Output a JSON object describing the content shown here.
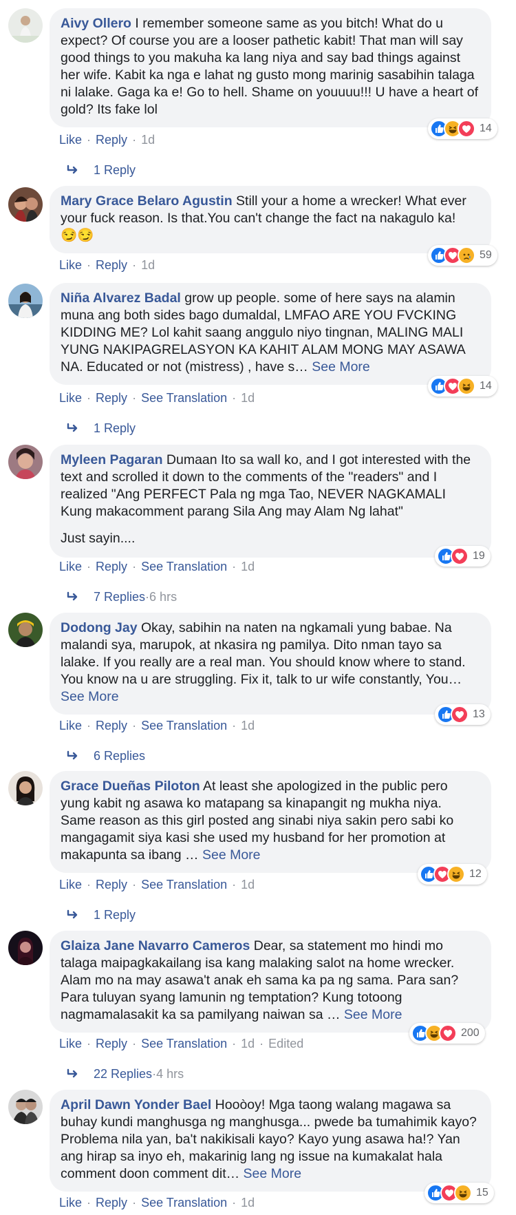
{
  "labels": {
    "like": "Like",
    "reply": "Reply",
    "see_translation": "See Translation",
    "see_more": "See More"
  },
  "colors": {
    "link": "#385898",
    "meta": "#90949c",
    "bubble": "#f2f3f5",
    "like": "#1877f2",
    "love": "#f33e58",
    "haha": "#f7b125"
  },
  "comments": [
    {
      "author": "Aivy Ollero",
      "text": " I remember someone same as you bitch! What do u expect? Of course you are a looser pathetic kabit! That man will say good things to you makuha ka lang niya and say bad things against her wife. Kabit ka nga e lahat ng gusto mong marinig sasabihin talaga ni lalake. Gaga ka e! Go to hell. Shame on youuuu!!! U have a heart of gold? Its fake lol",
      "time": "1d",
      "reactions": [
        "like-icon",
        "haha-icon",
        "love-icon"
      ],
      "reaction_count": "14",
      "replies": "1 Reply"
    },
    {
      "author": "Mary Grace Belaro Agustin",
      "text": " Still your a home a wrecker! What ever your fuck reason. Is that.You can't change the fact na nakagulo ka!",
      "emoji": "😏😏",
      "time": "1d",
      "reactions": [
        "like-icon",
        "love-icon",
        "sad-icon"
      ],
      "reaction_count": "59"
    },
    {
      "author": "Niña Alvarez Badal",
      "text": " grow up people. some of here says na alamin muna ang both sides bago dumaldal, LMFAO ARE YOU FVCKING KIDDING ME? Lol kahit saang anggulo niyo tingnan, MALING MALI YUNG NAKIPAGRELASYON KA KAHIT ALAM MONG MAY ASAWA NA. Educated or not (mistress) , have s…",
      "time": "1d",
      "reactions": [
        "like-icon",
        "love-icon",
        "haha-icon"
      ],
      "reaction_count": "14",
      "replies": "1 Reply"
    },
    {
      "author": "Myleen Pagaran",
      "text": " Dumaan Ito sa wall ko, and I got interested with the text and scrolled it down to the comments of the \"readers\" and I realized \"Ang PERFECT Pala ng mga Tao, NEVER NAGKAMALI Kung makacomment parang Sila Ang may Alam Ng lahat\"",
      "extra": "Just sayin....",
      "time": "1d",
      "reactions": [
        "like-icon",
        "love-icon"
      ],
      "reaction_count": "19",
      "replies": "7 Replies",
      "replies_time": "6 hrs"
    },
    {
      "author": "Dodong Jay",
      "text": " Okay, sabihin na naten na ngkamali yung babae. Na malandi sya, marupok, at nkasira ng pamilya. Dito nman tayo sa lalake. If you really are a real man. You should know where to stand. You know na u are struggling. Fix it, talk to ur wife constantly, You…",
      "time": "1d",
      "reactions": [
        "like-icon",
        "love-icon"
      ],
      "reaction_count": "13",
      "replies": "6 Replies"
    },
    {
      "author": "Grace Dueñas Piloton",
      "text": " At least she apologized in the public pero yung kabit ng asawa ko matapang sa kinapangit ng mukha niya. Same reason as this girl posted ang sinabi niya sakin pero sabi ko mangagamit siya kasi she used my husband for her promotion at makapunta sa ibang …",
      "time": "1d",
      "reactions": [
        "like-icon",
        "love-icon",
        "haha-icon"
      ],
      "reaction_count": "12",
      "replies": "1 Reply"
    },
    {
      "author": "Glaiza Jane Navarro Cameros",
      "text": " Dear, sa statement mo hindi mo talaga maipagkakailang isa kang malaking salot na home wrecker. Alam mo na may asawa't anak eh sama ka pa ng sama. Para san? Para tuluyan syang lamunin ng temptation? Kung totoong nagmamalasakit ka sa pamilyang naiwan sa …",
      "time": "1d",
      "edited": "Edited",
      "reactions": [
        "like-icon",
        "haha-icon",
        "love-icon"
      ],
      "reaction_count": "200",
      "replies": "22 Replies",
      "replies_time": "4 hrs"
    },
    {
      "author": "April Dawn Yonder Bael",
      "text": " Hooòoy! Mga taong walang magawa sa buhay kundi manghusga ng manghusga... pwede ba tumahimik kayo? Problema nila yan, ba't nakikisali kayo? Kayo yung asawa ha!? Yan ang hirap sa inyo eh, makarinig lang ng issue na kumakalat hala comment doon comment dit…",
      "time": "1d",
      "reactions": [
        "like-icon",
        "love-icon",
        "haha-icon"
      ],
      "reaction_count": "15"
    }
  ]
}
